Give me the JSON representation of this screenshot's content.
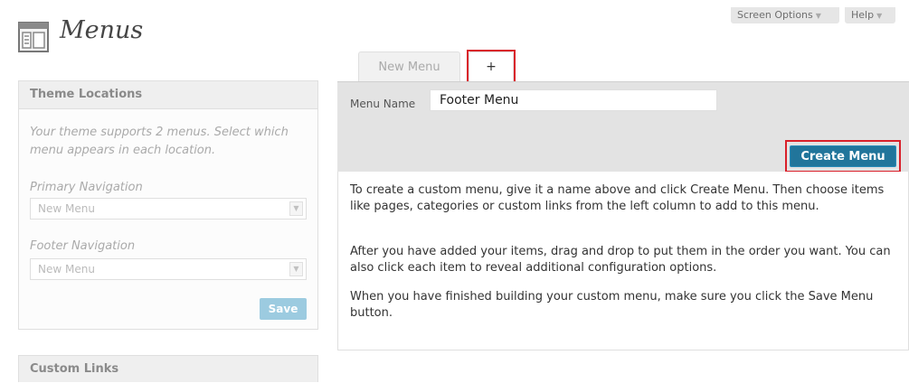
{
  "header": {
    "title": "Menus",
    "screen_options": "Screen Options",
    "help": "Help"
  },
  "tabs": [
    {
      "label": "New Menu"
    },
    {
      "label": "+"
    }
  ],
  "editor": {
    "menu_name_label": "Menu Name",
    "menu_name_value": "Footer Menu",
    "create_button": "Create Menu",
    "paragraphs": [
      "To create a custom menu, give it a name above and click Create Menu. Then choose items like pages, categories or custom links from the left column to add to this menu.",
      "After you have added your items, drag and drop to put them in the order you want. You can also click each item to reveal additional configuration options.",
      "When you have finished building your custom menu, make sure you click the Save Menu button."
    ]
  },
  "theme_locations": {
    "title": "Theme Locations",
    "description": "Your theme supports 2 menus. Select which menu appears in each location.",
    "locations": [
      {
        "label": "Primary Navigation",
        "selected": "New Menu"
      },
      {
        "label": "Footer Navigation",
        "selected": "New Menu"
      }
    ],
    "save_button": "Save"
  },
  "custom_links": {
    "title": "Custom Links"
  },
  "colors": {
    "primary_button": "#21759b",
    "highlight": "#d9202a",
    "disabled_button": "#9ccbe0"
  },
  "icons": [
    "menus-icon",
    "dropdown-arrow-icon"
  ]
}
